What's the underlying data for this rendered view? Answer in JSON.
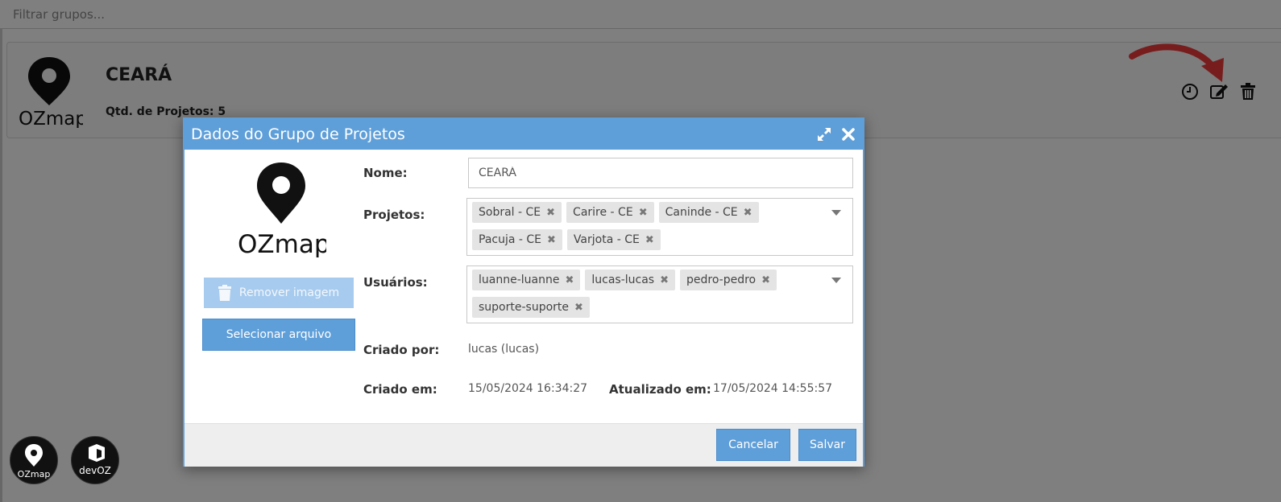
{
  "filter": {
    "placeholder": "Filtrar grupos..."
  },
  "group": {
    "title": "CEARÁ",
    "count_label": "Qtd. de Projetos: 5",
    "logo_text": "OZmap"
  },
  "modal": {
    "title": "Dados do Grupo de Projetos",
    "logo_text": "OZmap",
    "remove_image_label": "Remover imagem",
    "select_file_label": "Selecionar arquivo",
    "fields": {
      "name_label": "Nome:",
      "name_value": "CEARÁ",
      "projects_label": "Projetos:",
      "projects": [
        "Sobral - CE",
        "Carire - CE",
        "Caninde - CE",
        "Pacuja - CE",
        "Varjota - CE"
      ],
      "users_label": "Usuários:",
      "users": [
        "luanne-luanne",
        "lucas-lucas",
        "pedro-pedro",
        "suporte-suporte"
      ],
      "created_by_label": "Criado por:",
      "created_by_value": "lucas (lucas)",
      "created_at_label": "Criado em:",
      "created_at_value": "15/05/2024 16:34:27",
      "updated_at_label": "Atualizado em:",
      "updated_at_value": "17/05/2024 14:55:57"
    },
    "cancel_label": "Cancelar",
    "save_label": "Salvar"
  },
  "badges": [
    {
      "name": "ozmap-badge",
      "text": "OZmap"
    },
    {
      "name": "devoz-badge",
      "text": "devOZ"
    }
  ],
  "colors": {
    "primary": "#5f9fd9",
    "primary_disabled": "#a7cbee",
    "tag_bg": "#e4e4e4",
    "arrow_red": "#ee3b3b"
  }
}
